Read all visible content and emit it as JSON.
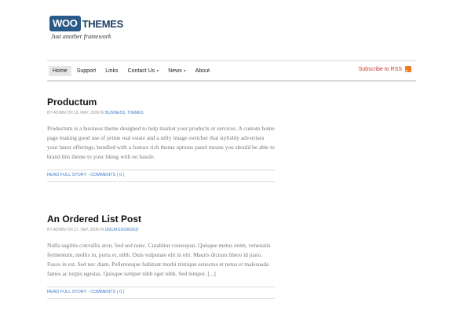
{
  "logo": {
    "woo": "WOO",
    "themes": "THEMES",
    "tagline": "Just another framework"
  },
  "nav": {
    "items": [
      {
        "label": "Home",
        "active": true
      },
      {
        "label": "Support"
      },
      {
        "label": "Links"
      },
      {
        "label": "Contact Us",
        "caret": "▾"
      },
      {
        "label": "News",
        "caret": "▾"
      },
      {
        "label": "About"
      }
    ],
    "rss_label": "Subscribe to RSS"
  },
  "posts": [
    {
      "title": "Productum",
      "meta": {
        "by": "by ADMIN on 18. MAY, 2009 in",
        "categories": "BUSINESS, THEMES"
      },
      "excerpt": "Productum is a business theme designed to help market your products or services. A custom home page making good use of prime real estate and a nifty image switcher that stylishly advertises your latest offerings, bundled with a feature rich theme options panel means you should be able to brand this theme to your liking with no hassle.",
      "read_more": "READ FULL STORY",
      "sep": " - ",
      "comments": "COMMENTS { 0 }"
    },
    {
      "title": "An Ordered List Post",
      "meta": {
        "by": "by ADMIN on 17. SEP, 2008 in",
        "categories": "UNCATEGORIZED"
      },
      "excerpt": "Nulla sagittis convallis arcu. Sed sed nunc. Curabitur consequat. Quisque metus enim, venenatis fermentum, mollis in, porta et, nibh. Duis vulputate elit in elit. Mauris dictum libero id justo. Fusce in est. Sed nec diam. Pellentesque habitant morbi tristique senectus et netus et malesuada fames ac turpis egestas. Quisque semper nibh eget nibh. Sed tempor. [...]",
      "read_more": "READ FULL STORY",
      "sep": " - ",
      "comments": "COMMENTS { 0 }"
    }
  ],
  "colors": {
    "accent": "#3b7cc6",
    "rss": "#c0392b",
    "logo": "#2a5a8a"
  }
}
